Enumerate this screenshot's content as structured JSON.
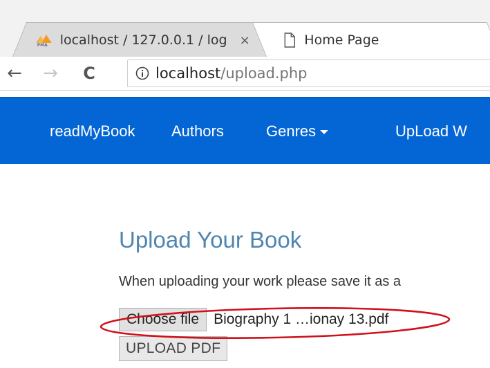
{
  "browser": {
    "tabs": [
      {
        "title": "localhost / 127.0.0.1 / log",
        "close_glyph": "×",
        "icon": "phpmyadmin-icon"
      },
      {
        "title": "Home Page",
        "icon": "document-icon"
      }
    ],
    "toolbar": {
      "back_glyph": "←",
      "forward_glyph": "→",
      "reload_glyph": "C",
      "url_host": "localhost",
      "url_path": "/upload.php"
    }
  },
  "navbar": {
    "brand": "readMyBook",
    "items": [
      {
        "label": "Authors"
      },
      {
        "label": "Genres"
      },
      {
        "label": "UpLoad W"
      }
    ],
    "background": "#0466d4"
  },
  "main": {
    "heading": "Upload Your Book",
    "description": "When uploading your work please save it as a",
    "file_input": {
      "button_label": "Choose file",
      "selected_file": "Biography 1 …ionay 13.pdf"
    },
    "submit_label": "UPLOAD PDF",
    "heading_color": "#4e86b0",
    "annotation_color": "#d0101a"
  }
}
